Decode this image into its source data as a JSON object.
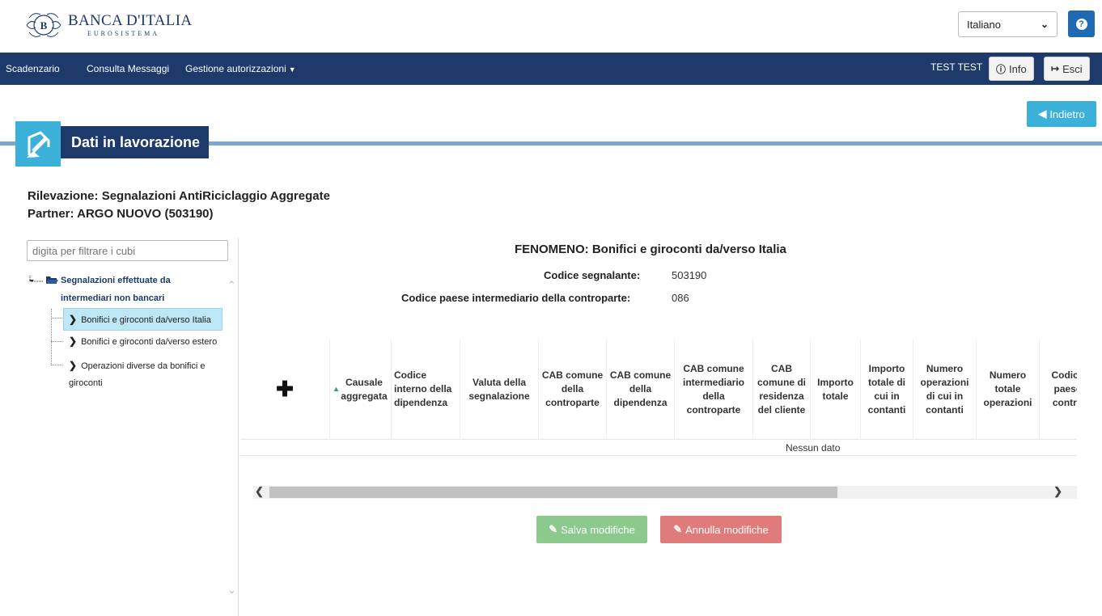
{
  "header": {
    "logo_name": "BANCA D'ITALIA",
    "logo_sub": "EUROSISTEMA",
    "language_selected": "Italiano"
  },
  "nav": {
    "items": [
      "Scadenzario",
      "Consulta Messaggi",
      "Gestione autorizzazioni"
    ],
    "user": "TEST TEST",
    "info_label": "Info",
    "exit_label": "Esci"
  },
  "back_label": "Indietro",
  "section_title": "Dati in lavorazione",
  "rilevazione": "Rilevazione: Segnalazioni AntiRiciclaggio Aggregate",
  "partner": "Partner: ARGO NUOVO (503190)",
  "sidebar": {
    "filter_placeholder": "digita per filtrare i cubi",
    "root_line1": "Segnalazioni effettuate da",
    "root_line2": "intermediari non bancari",
    "items": [
      "Bonifici e giroconti da/verso Italia",
      "Bonifici e giroconti da/verso estero",
      "Operazioni diverse da bonifici e",
      "giroconti"
    ]
  },
  "main": {
    "fenomeno": "FENOMENO: Bonifici e giroconti da/verso Italia",
    "codice_segnalante_label": "Codice segnalante:",
    "codice_segnalante_value": "503190",
    "codice_paese_label": "Codice paese intermediario della controparte:",
    "codice_paese_value": "086",
    "columns": [
      "Causale aggregata",
      "Codice interno della dipendenza",
      "Valuta della segnalazione",
      "CAB comune della controparte",
      "CAB comune della dipendenza",
      "CAB comune intermediario della controparte",
      "CAB comune di residenza del cliente",
      "Importo totale",
      "Importo totale di cui in contanti",
      "Numero operazioni di cui in contanti",
      "Numero totale operazioni",
      "Codice paese contro"
    ],
    "no_data": "Nessun dato",
    "save_label": "Salva modifiche",
    "cancel_label": "Annulla modifiche"
  }
}
